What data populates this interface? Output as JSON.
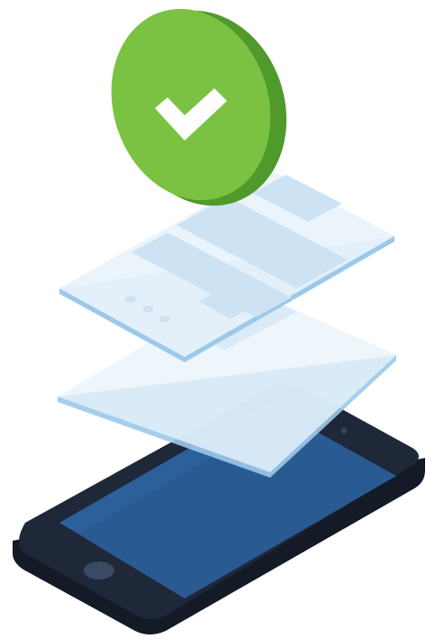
{
  "illustration": {
    "kind": "isometric-mobile-verification-graphic",
    "colors": {
      "badge_face": "#7cc242",
      "badge_edge": "#4f9a2a",
      "badge_check": "#ffffff",
      "panel_fill": "#e9f3fb",
      "panel_edge": "#9cc9ea",
      "panel_element": "#cde3f3",
      "phone_body": "#1e2838",
      "phone_edge": "#141b26",
      "phone_screen": "#2a5a92",
      "phone_button": "#3a4a62"
    },
    "icons": [
      "checkmark-icon",
      "home-button-icon"
    ],
    "layers": [
      "verified-badge",
      "form-panel",
      "blank-panel",
      "smartphone"
    ],
    "form_panel": {
      "field_count": 4,
      "dot_count": 3
    }
  }
}
